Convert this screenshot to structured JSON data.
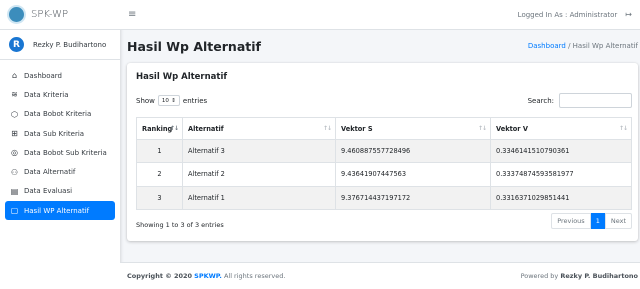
{
  "brand": {
    "name": "SPK-WP"
  },
  "user": {
    "initial": "R",
    "name": "Rezky P. Budihartono"
  },
  "sidebar": {
    "items": [
      {
        "label": "Dashboard",
        "icon": "home-icon",
        "glyph": "⌂"
      },
      {
        "label": "Data Kriteria",
        "icon": "layers-icon",
        "glyph": "≋"
      },
      {
        "label": "Data Bobot Kriteria",
        "icon": "cube-icon",
        "glyph": "⬡"
      },
      {
        "label": "Data Sub Kriteria",
        "icon": "grid-icon",
        "glyph": "⊞"
      },
      {
        "label": "Data Bobot Sub Kriteria",
        "icon": "target-icon",
        "glyph": "◎"
      },
      {
        "label": "Data Alternatif",
        "icon": "users-icon",
        "glyph": "⚇"
      },
      {
        "label": "Data Evaluasi",
        "icon": "document-icon",
        "glyph": "▤"
      },
      {
        "label": "Hasil WP Alternatif",
        "icon": "clipboard-icon",
        "glyph": "▢",
        "active": true
      }
    ]
  },
  "topbar": {
    "logged_in": "Logged In As : Administrator"
  },
  "header": {
    "title": "Hasil Wp Alternatif",
    "breadcrumb_link": "Dashboard",
    "breadcrumb_sep": "/",
    "breadcrumb_current": "Hasil Wp Alternatif"
  },
  "card": {
    "title": "Hasil Wp Alternatif",
    "show_label": "Show",
    "entries_value": "10",
    "entries_label": "entries",
    "search_label": "Search:",
    "search_value": ""
  },
  "table": {
    "columns": [
      "Ranking",
      "Alternatif",
      "Vektor S",
      "Vektor V"
    ],
    "rows": [
      [
        "1",
        "Alternatif 3",
        "9.460887557728496",
        "0.3346141510790361"
      ],
      [
        "2",
        "Alternatif 2",
        "9.43641907447563",
        "0.33374874593581977"
      ],
      [
        "3",
        "Alternatif 1",
        "9.376714437197172",
        "0.3316371029851441"
      ]
    ]
  },
  "pagination": {
    "info": "Showing 1 to 3 of 3 entries",
    "previous": "Previous",
    "current": "1",
    "next": "Next"
  },
  "footer": {
    "copyright": "Copyright © 2020",
    "brand": "SPKWP.",
    "rights": "All rights reserved.",
    "powered_prefix": "Powered by",
    "powered_name": "Rezky P. Budihartono"
  },
  "colors": {
    "primary": "#007bff",
    "brand_logo": "#3c8dbc",
    "avatar": "#1976d2"
  }
}
